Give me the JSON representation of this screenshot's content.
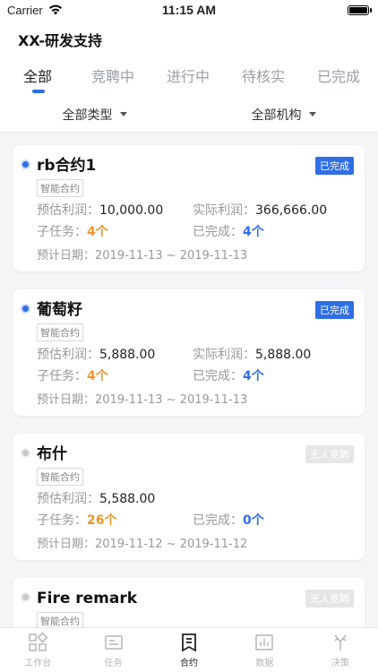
{
  "status": {
    "carrier": "Carrier",
    "time": "11:15 AM",
    "battery_level": 1.0
  },
  "nav": {
    "title": "XX-研发支持"
  },
  "tabs": [
    {
      "label": "全部",
      "active": true
    },
    {
      "label": "竞聘中",
      "active": false
    },
    {
      "label": "进行中",
      "active": false
    },
    {
      "label": "待核实",
      "active": false
    },
    {
      "label": "已完成",
      "active": false
    }
  ],
  "filters": {
    "type": "全部类型",
    "org": "全部机构"
  },
  "labels": {
    "est_profit": "预估利润：",
    "actual_profit": "实际利润：",
    "subtasks": "子任务：",
    "completed": "已完成：",
    "date": "预计日期："
  },
  "cards": [
    {
      "title": "rb合约1",
      "status": "已完成",
      "status_color": "#2f6fe6",
      "tag": "智能合约",
      "est": "10,000.00",
      "actual": "366,666.00",
      "subtasks": "4个",
      "done": "4个",
      "dates": "2019-11-13 ~ 2019-11-13"
    },
    {
      "title": "葡萄籽",
      "status": "已完成",
      "status_color": "#2f6fe6",
      "tag": "智能合约",
      "est": "5,888.00",
      "actual": "5,888.00",
      "subtasks": "4个",
      "done": "4个",
      "dates": "2019-11-13 ~ 2019-11-13"
    },
    {
      "title": "布什",
      "status": "无人竞聘",
      "status_color": "#e6e6e6",
      "tag": "智能合约",
      "est": "5,588.00",
      "subtasks": "26个",
      "done": "0个",
      "dates": "2019-11-12 ~ 2019-11-12"
    },
    {
      "title": "Fire remark",
      "status": "无人竞聘",
      "status_color": "#e6e6e6",
      "tag": "智能合约"
    }
  ],
  "tabbar": [
    {
      "label": "工作台",
      "icon": "grid-icon",
      "active": false
    },
    {
      "label": "任务",
      "icon": "task-icon",
      "active": false
    },
    {
      "label": "合约",
      "icon": "contract-icon",
      "active": true
    },
    {
      "label": "数据",
      "icon": "chart-icon",
      "active": false
    },
    {
      "label": "决策",
      "icon": "decision-icon",
      "active": false
    }
  ]
}
